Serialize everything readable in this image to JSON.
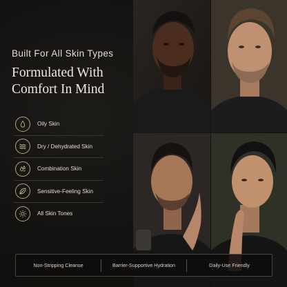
{
  "hero": {
    "eyebrow": "Built For All Skin Types",
    "headline_line1": "Formulated With",
    "headline_line2": "Comfort In Mind"
  },
  "skin_types": [
    {
      "label": "Oily Skin",
      "icon": "droplet-icon"
    },
    {
      "label": "Dry / Dehydrated Skin",
      "icon": "wave-lines-icon"
    },
    {
      "label": "Combination Skin",
      "icon": "split-drop-icon"
    },
    {
      "label": "Sensitive-Feeling Skin",
      "icon": "leaf-icon"
    },
    {
      "label": "All Skin Tones",
      "icon": "sun-icon"
    }
  ],
  "benefits": [
    "Non-Stripping Cleanse",
    "Barrier-Supportive Hydration",
    "Daily-Use Friendly"
  ],
  "colors": {
    "background": "#121110",
    "accent_gold": "#b9a774",
    "text": "#e9e4da"
  }
}
